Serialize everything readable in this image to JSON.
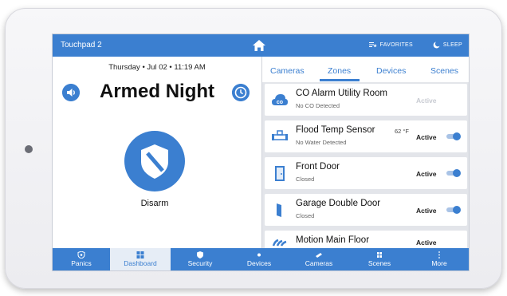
{
  "header": {
    "title": "Touchpad 2",
    "favorites": "FAVORITES",
    "sleep": "SLEEP"
  },
  "status": {
    "datetime": "Thursday • Jul 02 • 11:19 AM",
    "arm_state": "Armed Night",
    "disarm_label": "Disarm"
  },
  "tabs": [
    "Cameras",
    "Zones",
    "Devices",
    "Scenes"
  ],
  "zones": [
    {
      "name": "CO Alarm Utility Room",
      "status": "No CO Detected",
      "state": "Active",
      "temp": ""
    },
    {
      "name": "Flood Temp Sensor",
      "status": "No Water Detected",
      "state": "Active",
      "temp": "62 °F"
    },
    {
      "name": "Front Door",
      "status": "Closed",
      "state": "Active",
      "temp": ""
    },
    {
      "name": "Garage Double Door",
      "status": "Closed",
      "state": "Active",
      "temp": ""
    },
    {
      "name": "Motion Main Floor",
      "status": "",
      "state": "Active",
      "temp": ""
    }
  ],
  "nav": [
    "Panics",
    "Dashboard",
    "Security",
    "Devices",
    "Cameras",
    "Scenes",
    "More"
  ],
  "colors": {
    "accent": "#3b7fd0",
    "panel_bg": "#e3e5ea"
  }
}
